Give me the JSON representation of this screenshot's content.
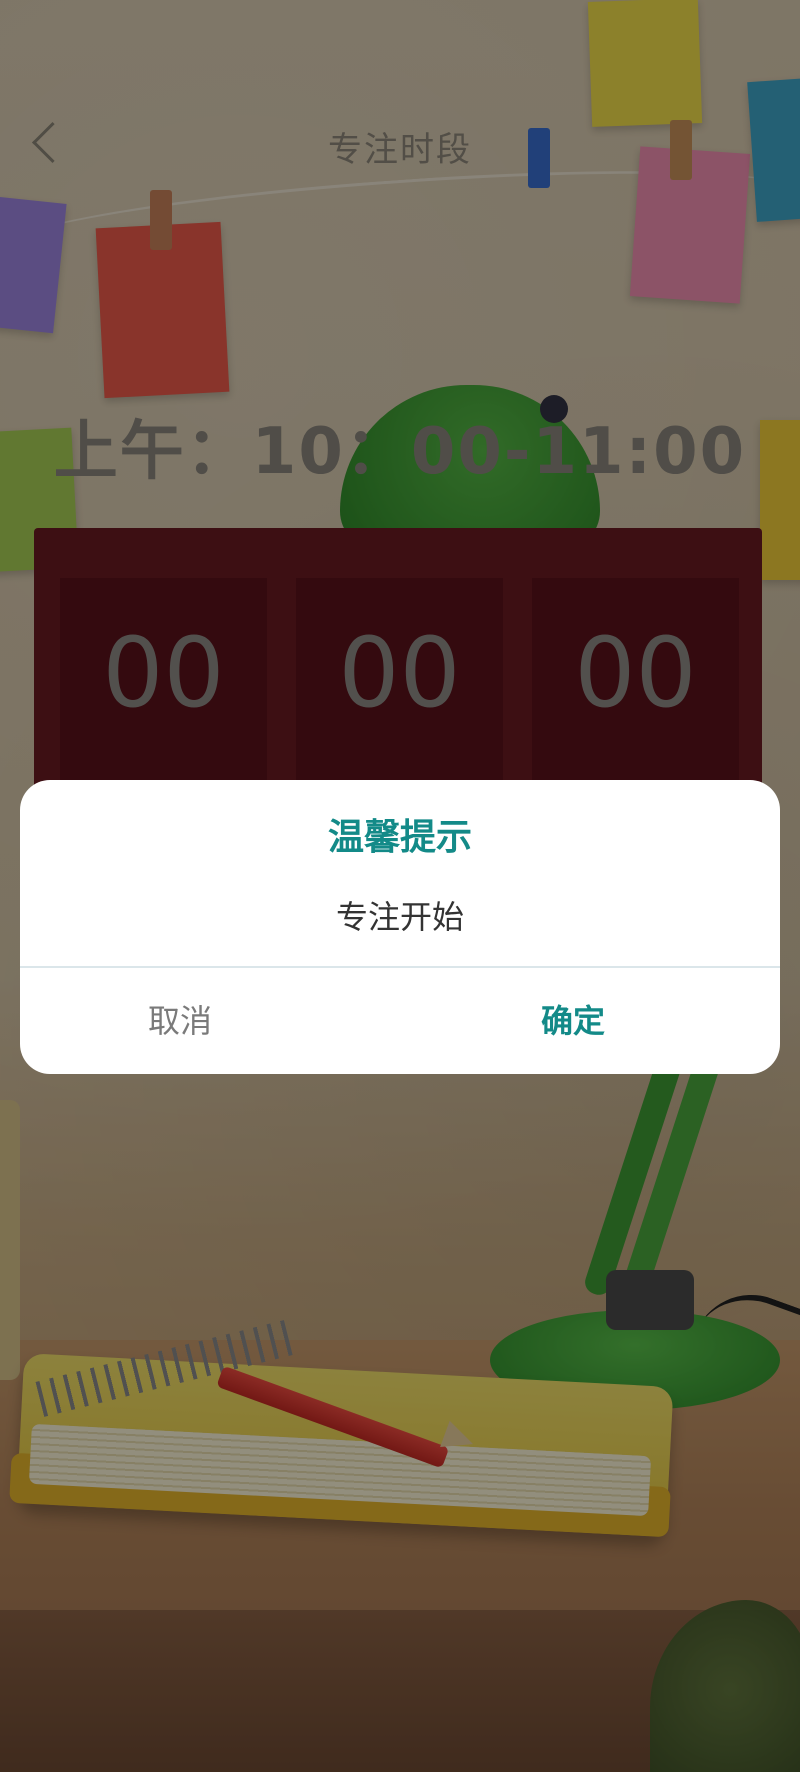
{
  "header": {
    "back_icon": "chevron-left-icon",
    "title": "专注时段"
  },
  "session": {
    "time_range": "上午：10：00-11:00"
  },
  "timer": {
    "hours": "00",
    "minutes": "00",
    "seconds": "00"
  },
  "dialog": {
    "title": "温馨提示",
    "message": "专注开始",
    "cancel_label": "取消",
    "confirm_label": "确定"
  },
  "colors": {
    "accent": "#138a88",
    "timer_panel": "#6a1a22",
    "timer_box": "#5b121b",
    "overlay": "rgba(0,0,0,0.42)"
  }
}
